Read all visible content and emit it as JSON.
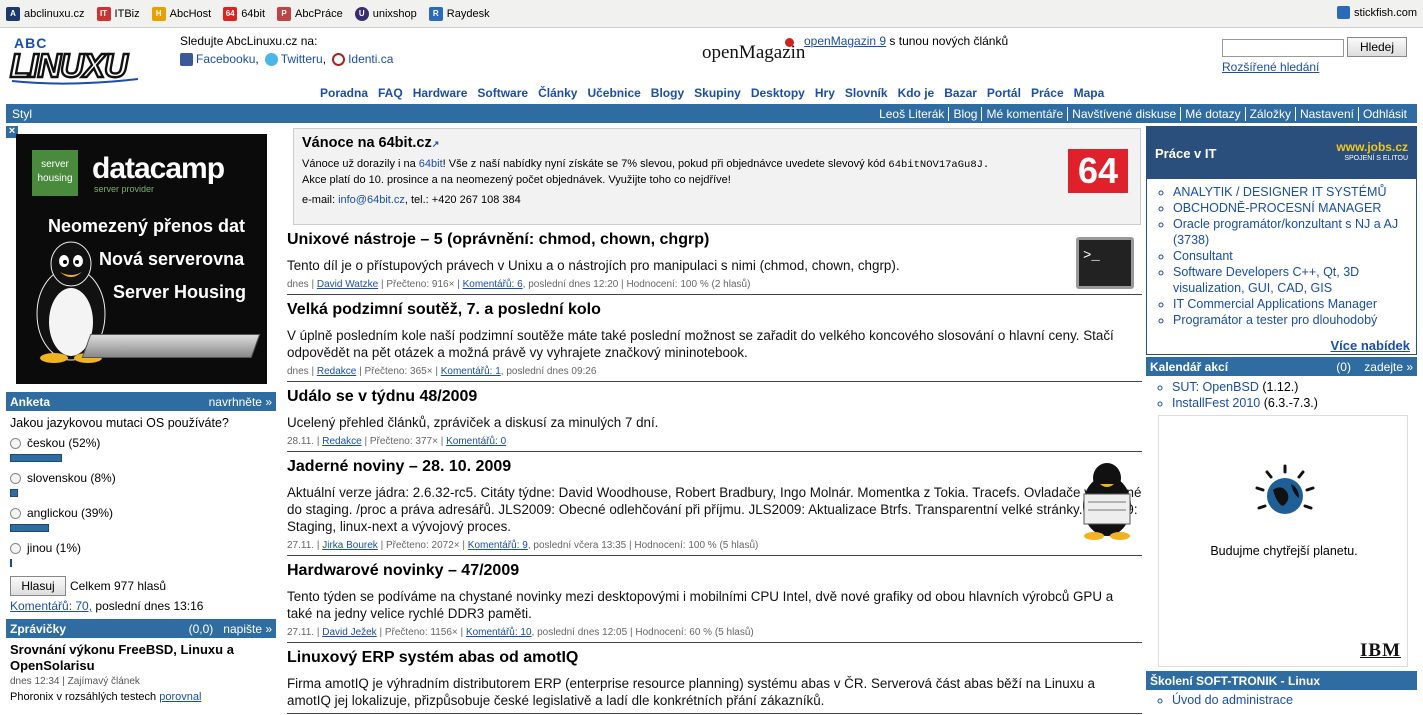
{
  "bookmarks": [
    {
      "label": "abclinuxu.cz",
      "color": "#1b3a6b"
    },
    {
      "label": "ITBiz",
      "color": "#c33"
    },
    {
      "label": "AbcHost",
      "color": "#e6a100"
    },
    {
      "label": "64bit",
      "color": "#d22"
    },
    {
      "label": "AbcPráce",
      "color": "#b44"
    },
    {
      "label": "unixshop",
      "color": "#3a2d6e"
    },
    {
      "label": "Raydesk",
      "color": "#2a6ab8"
    }
  ],
  "bookmark_right": "stickfish.com",
  "header": {
    "follow_title": "Sledujte AbcLinuxu.cz na:",
    "facebook": "Facebooku",
    "twitter": "Twitteru",
    "identica": "Identi.ca",
    "openmag_logo": "openMagazin",
    "openmag_link": "openMagazin 9",
    "openmag_text": " s tunou nových článků",
    "search_button": "Hledej",
    "advanced": "Rozšířené hledání"
  },
  "nav": [
    "Poradna",
    "FAQ",
    "Hardware",
    "Software",
    "Články",
    "Učebnice",
    "Blogy",
    "Skupiny",
    "Desktopy",
    "Hry",
    "Slovník",
    "Kdo je",
    "Bazar",
    "Portál",
    "Práce",
    "Mapa"
  ],
  "userbar": {
    "left": "Styl",
    "items": [
      "Leoš Literák",
      "Blog",
      "Mé komentáře",
      "Navštívené diskuse",
      "Mé dotazy",
      "Záložky",
      "Nastavení",
      "Odhlásit"
    ]
  },
  "ad_left": {
    "close": "×",
    "badge_top": "server",
    "badge_bottom": "housing",
    "brand": "datacamp",
    "brand_sub": "server provider",
    "lines": [
      "Neomezený přenos dat",
      "Nová serverovna",
      "Server Housing"
    ]
  },
  "poll": {
    "title": "Anketa",
    "action": "navrhněte »",
    "question": "Jakou jazykovou mutaci OS používáte?",
    "options": [
      {
        "label": "českou (52%)",
        "percent": 52
      },
      {
        "label": "slovenskou (8%)",
        "percent": 8
      },
      {
        "label": "anglickou (39%)",
        "percent": 39
      },
      {
        "label": "jinou (1%)",
        "percent": 1
      }
    ],
    "vote": "Hlasuj",
    "total": "Celkem 977 hlasů",
    "comments": "Komentářů: 70,",
    "last": " poslední dnes 13:16"
  },
  "news": {
    "title": "Zprávičky",
    "count": "(0,0)",
    "action": "napište »",
    "item_title": "Srovnání výkonu FreeBSD, Linuxu a OpenSolarisu",
    "item_meta": "dnes 12:34 | Zajímavý článek",
    "item_text": "Phoronix v rozsáhlých testech",
    "item_link": "porovnal"
  },
  "promo": {
    "title": "Vánoce na 64bit.cz",
    "line1_a": "Vánoce už dorazily i na ",
    "line1_link": "64bit",
    "line1_b": "! Vše z naší nabídky nyní získáte se 7% slevou, pokud při objednávce uvedete slevový kód ",
    "code": "64bitNOV17aGu8J.",
    "line2": "Akce platí do 10. prosince a na neomezený počet objednávek. Využijte toho co nejdříve!",
    "email_label": "e-mail: ",
    "email": "info@64bit.cz",
    "phone": ", tel.: +420 267 108 384",
    "logo": "64"
  },
  "articles": [
    {
      "title": "Unixové nástroje – 5 (oprávnění: chmod, chown, chgrp)",
      "text": "Tento díl je o přístupových právech v Unixu a o nástrojích pro manipulaci s nimi (chmod, chown, chgrp).",
      "date": "dnes",
      "author": "David Watzke",
      "read": "Přečteno: 916×",
      "comments": "Komentářů: 6",
      "last": "poslední dnes 12:20",
      "rating": "Hodnocení: 100 % (2 hlasů)"
    },
    {
      "title": "Velká podzimní soutěž, 7. a poslední kolo",
      "text": "V úplně posledním kole naší podzimní soutěže máte také poslední možnost se zařadit do velkého koncového slosování o hlavní ceny. Stačí odpovědět na pět otázek a možná právě vy vyhrajete značkový mininotebook.",
      "date": "dnes",
      "author": "Redakce",
      "read": "Přečteno: 365×",
      "comments": "Komentářů: 1",
      "last": "poslední dnes 09:26",
      "rating": ""
    },
    {
      "title": "Událo se v týdnu 48/2009",
      "text": "Ucelený přehled článků, zpráviček a diskusí za minulých 7 dní.",
      "date": "28.11.",
      "author": "Redakce",
      "read": "Přečteno: 377×",
      "comments": "Komentářů: 0",
      "last": "",
      "rating": ""
    },
    {
      "title": "Jaderné noviny – 28. 10. 2009",
      "text": "Aktuální verze jádra: 2.6.32-rc5. Citáty týdne: David Woodhouse, Robert Bradbury, Ingo Molnár. Momentka z Tokia. Tracefs. Ovladače vyhozené do staging. /proc a práva adresářů. JLS2009: Obecné odlehčování při příjmu. JLS2009: Aktualizace Btrfs. Transparentní velké stránky. KS2009: Staging, linux-next a vývojový proces.",
      "date": "27.11.",
      "author": "Jirka Bourek",
      "read": "Přečteno: 2072×",
      "comments": "Komentářů: 9",
      "last": "poslední včera 13:35",
      "rating": "Hodnocení: 100 % (5 hlasů)"
    },
    {
      "title": "Hardwarové novinky – 47/2009",
      "text": "Tento týden se podíváme na chystané novinky mezi desktopovými i mobilními CPU Intel, dvě nové grafiky od obou hlavních výrobců GPU a také na jedny velice rychlé DDR3 paměti.",
      "date": "27.11.",
      "author": "David Ježek",
      "read": "Přečteno: 1156×",
      "comments": "Komentářů: 10",
      "last": "poslední dnes 12:05",
      "rating": "Hodnocení: 60 % (5 hlasů)"
    },
    {
      "title": "Linuxový ERP systém abas od amotIQ",
      "text": "Firma amotIQ je výhradním distributorem ERP (enterprise resource planning) systému abas v ČR. Serverová část abas běží na Linuxu a amotIQ jej lokalizuje, přizpůsobuje české legislativě a ladí dle konkrétních přání zákazníků.",
      "date": "",
      "author": "",
      "read": "",
      "comments": "",
      "last": "",
      "rating": ""
    }
  ],
  "jobs": {
    "title": "Práce v IT",
    "logo": "www.jobs.cz",
    "logo_sub": "SPOJENÍ S ELITOU",
    "items": [
      "ANALYTIK / DESIGNER IT SYSTÉMŮ",
      "OBCHODNĚ-PROCESNÍ MANAGER",
      "Oracle programátor/konzultant s NJ a AJ (3738)",
      "Consultant",
      "Software Developers C++, Qt, 3D visualization, GUI, CAD, GIS",
      "IT Commercial Applications Manager",
      "Programátor a tester pro dlouhodobý"
    ],
    "more": "Více nabídek"
  },
  "calendar": {
    "title": "Kalendář akcí",
    "count": "(0)",
    "action": "zadejte »",
    "events": [
      {
        "name": "SUT: OpenBSD",
        "date": " (1.12.)"
      },
      {
        "name": "InstallFest 2010",
        "date": " (6.3.-7.3.)"
      }
    ]
  },
  "ibm": {
    "text": "Budujme chytřejší planetu.",
    "logo": "IBM"
  },
  "training": {
    "title": "Školení SOFT-TRONIK - Linux",
    "item": "Úvod do administrace"
  }
}
